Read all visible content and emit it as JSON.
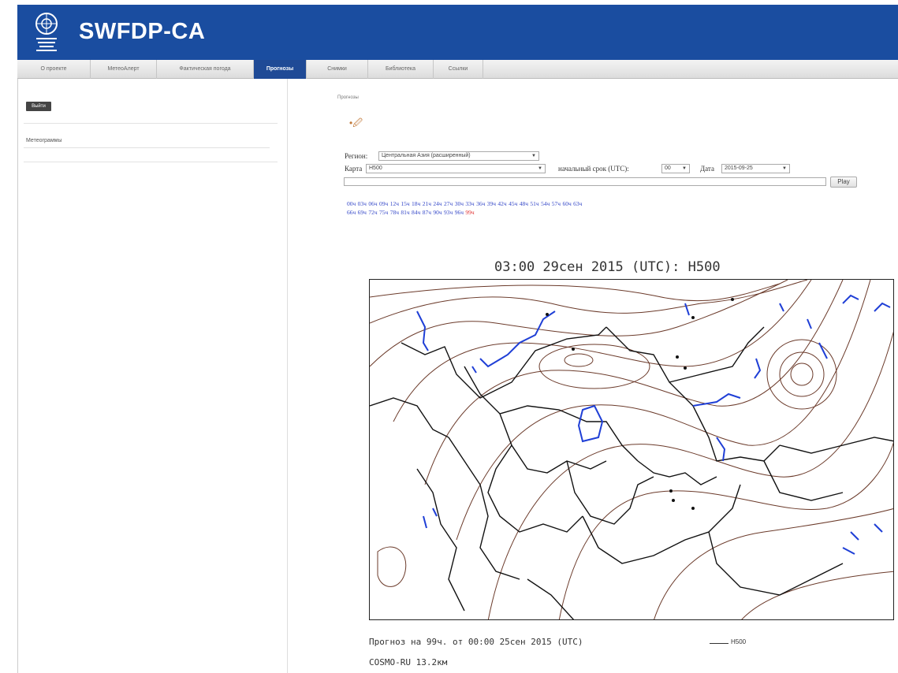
{
  "header": {
    "title": "SWFDP-CA"
  },
  "nav": {
    "items": [
      {
        "label": "О проекте"
      },
      {
        "label": "МетеоАлерт"
      },
      {
        "label": "Фактическая погода"
      },
      {
        "label": "Прогнозы"
      },
      {
        "label": "Снимки"
      },
      {
        "label": "Библиотека"
      },
      {
        "label": "Ссылки"
      }
    ],
    "active": "Прогнозы"
  },
  "sidebar": {
    "exit_label": "Выйти",
    "link_label": "Метеограммы"
  },
  "main": {
    "breadcrumb": "Прогнозы",
    "region_label": "Регион:",
    "region_value": "Центральная Азия (расширенный)",
    "map_label": "Карта",
    "map_value": "H500",
    "start_label": "начальный срок (UTC):",
    "start_value": "00",
    "date_label": "Дата",
    "date_value": "2015-09-25",
    "play_label": "Play",
    "hours_row1": [
      "00ч",
      "03ч",
      "06ч",
      "09ч",
      "12ч",
      "15ч",
      "18ч",
      "21ч",
      "24ч",
      "27ч",
      "30ч",
      "33ч",
      "36ч",
      "39ч",
      "42ч",
      "45ч",
      "48ч",
      "51ч",
      "54ч",
      "57ч",
      "60ч",
      "63ч"
    ],
    "hours_row2": [
      "66ч",
      "69ч",
      "72ч",
      "75ч",
      "78ч",
      "81ч",
      "84ч",
      "87ч",
      "90ч",
      "93ч",
      "96ч",
      "99ч"
    ],
    "current_hour": "99ч"
  },
  "map": {
    "title": "03:00 29сен 2015 (UTC): H500",
    "forecast_label": "Прогноз на 99ч. от 00:00 25сен 2015 (UTC)",
    "legend_label": "H500",
    "model_label": "COSMO-RU 13.2км"
  },
  "colors": {
    "header": "#1a4da0",
    "nav_active": "#1f4a96",
    "link": "#3548c8",
    "current_hour": "#e03030",
    "contour": "#6b3a2a",
    "water": "#1f3fd6"
  }
}
